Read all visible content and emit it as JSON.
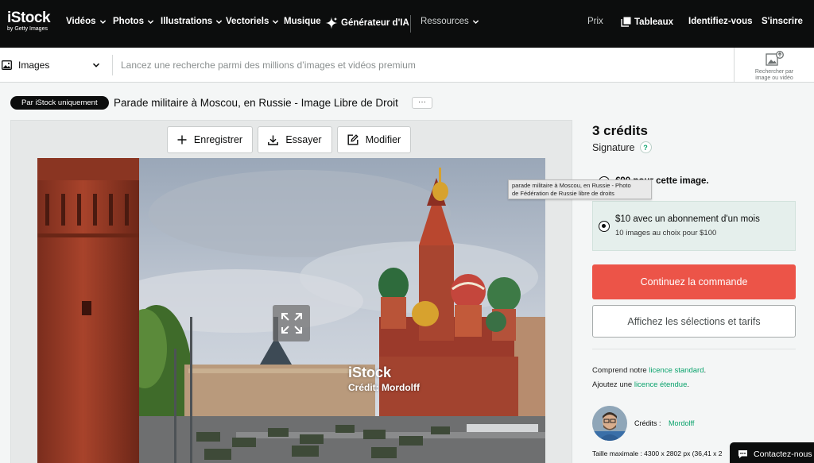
{
  "brand": {
    "name": "iStock",
    "sub": "by Getty Images"
  },
  "nav": {
    "items": [
      {
        "label": "Vidéos",
        "dropdown": true
      },
      {
        "label": "Photos",
        "dropdown": true
      },
      {
        "label": "Illustrations",
        "dropdown": true
      },
      {
        "label": "Vectoriels",
        "dropdown": true
      },
      {
        "label": "Musique",
        "dropdown": false
      },
      {
        "label": "Générateur d'IA",
        "dropdown": false,
        "icon": "sparkle-icon"
      },
      {
        "label": "Ressources",
        "dropdown": true
      }
    ],
    "right": {
      "pricing": "Prix",
      "boards": "Tableaux",
      "sign_in": "Identifiez-vous",
      "register": "S'inscrire"
    }
  },
  "search": {
    "type_label": "Images",
    "placeholder": "Lancez une recherche parmi des millions d’images et vidéos premium",
    "value": "",
    "visual_search_line1": "Rechercher par",
    "visual_search_line2": "image ou vidéo"
  },
  "asset": {
    "badge": "Par iStock uniquement",
    "title": "Parade militaire à Moscou, en Russie - Image Libre de Droit",
    "more_label": "···",
    "actions": {
      "save": "Enregistrer",
      "try": "Essayer",
      "edit": "Modifier"
    },
    "watermark_logo": "iStock",
    "watermark_credit": "Crédit: Mordolff",
    "tooltip_line1": "parade militaire à Moscou, en Russie - Photo",
    "tooltip_line2": "de Fédération de Russie libre de droits"
  },
  "purchase": {
    "credits": "3 crédits",
    "tier": "Signature",
    "option1": "€90 pour cette image.",
    "option2_title": "$10 avec un abonnement d'un mois",
    "option2_sub": "10 images au choix pour $100",
    "cta": "Continuez la commande",
    "secondary": "Affichez les sélections et tarifs"
  },
  "license": {
    "line1_prefix": "Comprend notre ",
    "line1_link": "licence standard",
    "line1_suffix": ".",
    "line2_prefix": "Ajoutez une ",
    "line2_link": "licence étendue",
    "line2_suffix": "."
  },
  "contributor": {
    "label": "Crédits :",
    "name": "Mordolff",
    "max_size": "Taille maximale : 4300 x 2802 px (36,41 x 2"
  },
  "support": {
    "label": "Contactez-nous"
  },
  "colors": {
    "topbar": "#0c0d0d",
    "cta": "#ec5448",
    "link": "#08a26b",
    "selected_option": "#e5efec"
  }
}
